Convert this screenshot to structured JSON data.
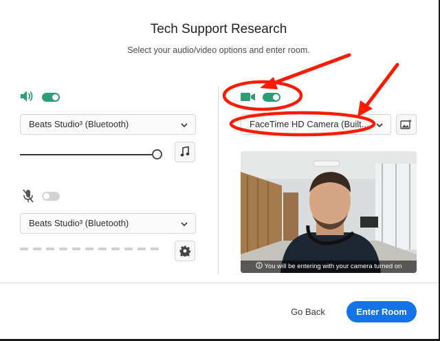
{
  "dialog": {
    "title": "Tech Support Research",
    "subtitle": "Select your audio/video options and enter room."
  },
  "audio": {
    "speaker_enabled": true,
    "speaker_device": "Beats Studio³ (Bluetooth)",
    "speaker_volume": 1.0,
    "mic_enabled": false,
    "mic_device": "Beats Studio³ (Bluetooth)"
  },
  "video": {
    "camera_enabled": true,
    "camera_device": "FaceTime HD Camera (Built...",
    "preview_caption": "You will be entering with your camera turned on"
  },
  "footer": {
    "back_label": "Go Back",
    "enter_label": "Enter Room"
  },
  "colors": {
    "accent_green": "#2d9d78",
    "primary_blue": "#1473e6",
    "annotation_red": "#ff1a00"
  },
  "icons": {
    "speaker": "speaker-volume-icon",
    "mic_muted": "mic-muted-icon",
    "camera": "video-camera-icon",
    "music": "music-note-icon",
    "settings": "gear-icon",
    "background": "image-effects-icon",
    "info": "info-icon"
  }
}
